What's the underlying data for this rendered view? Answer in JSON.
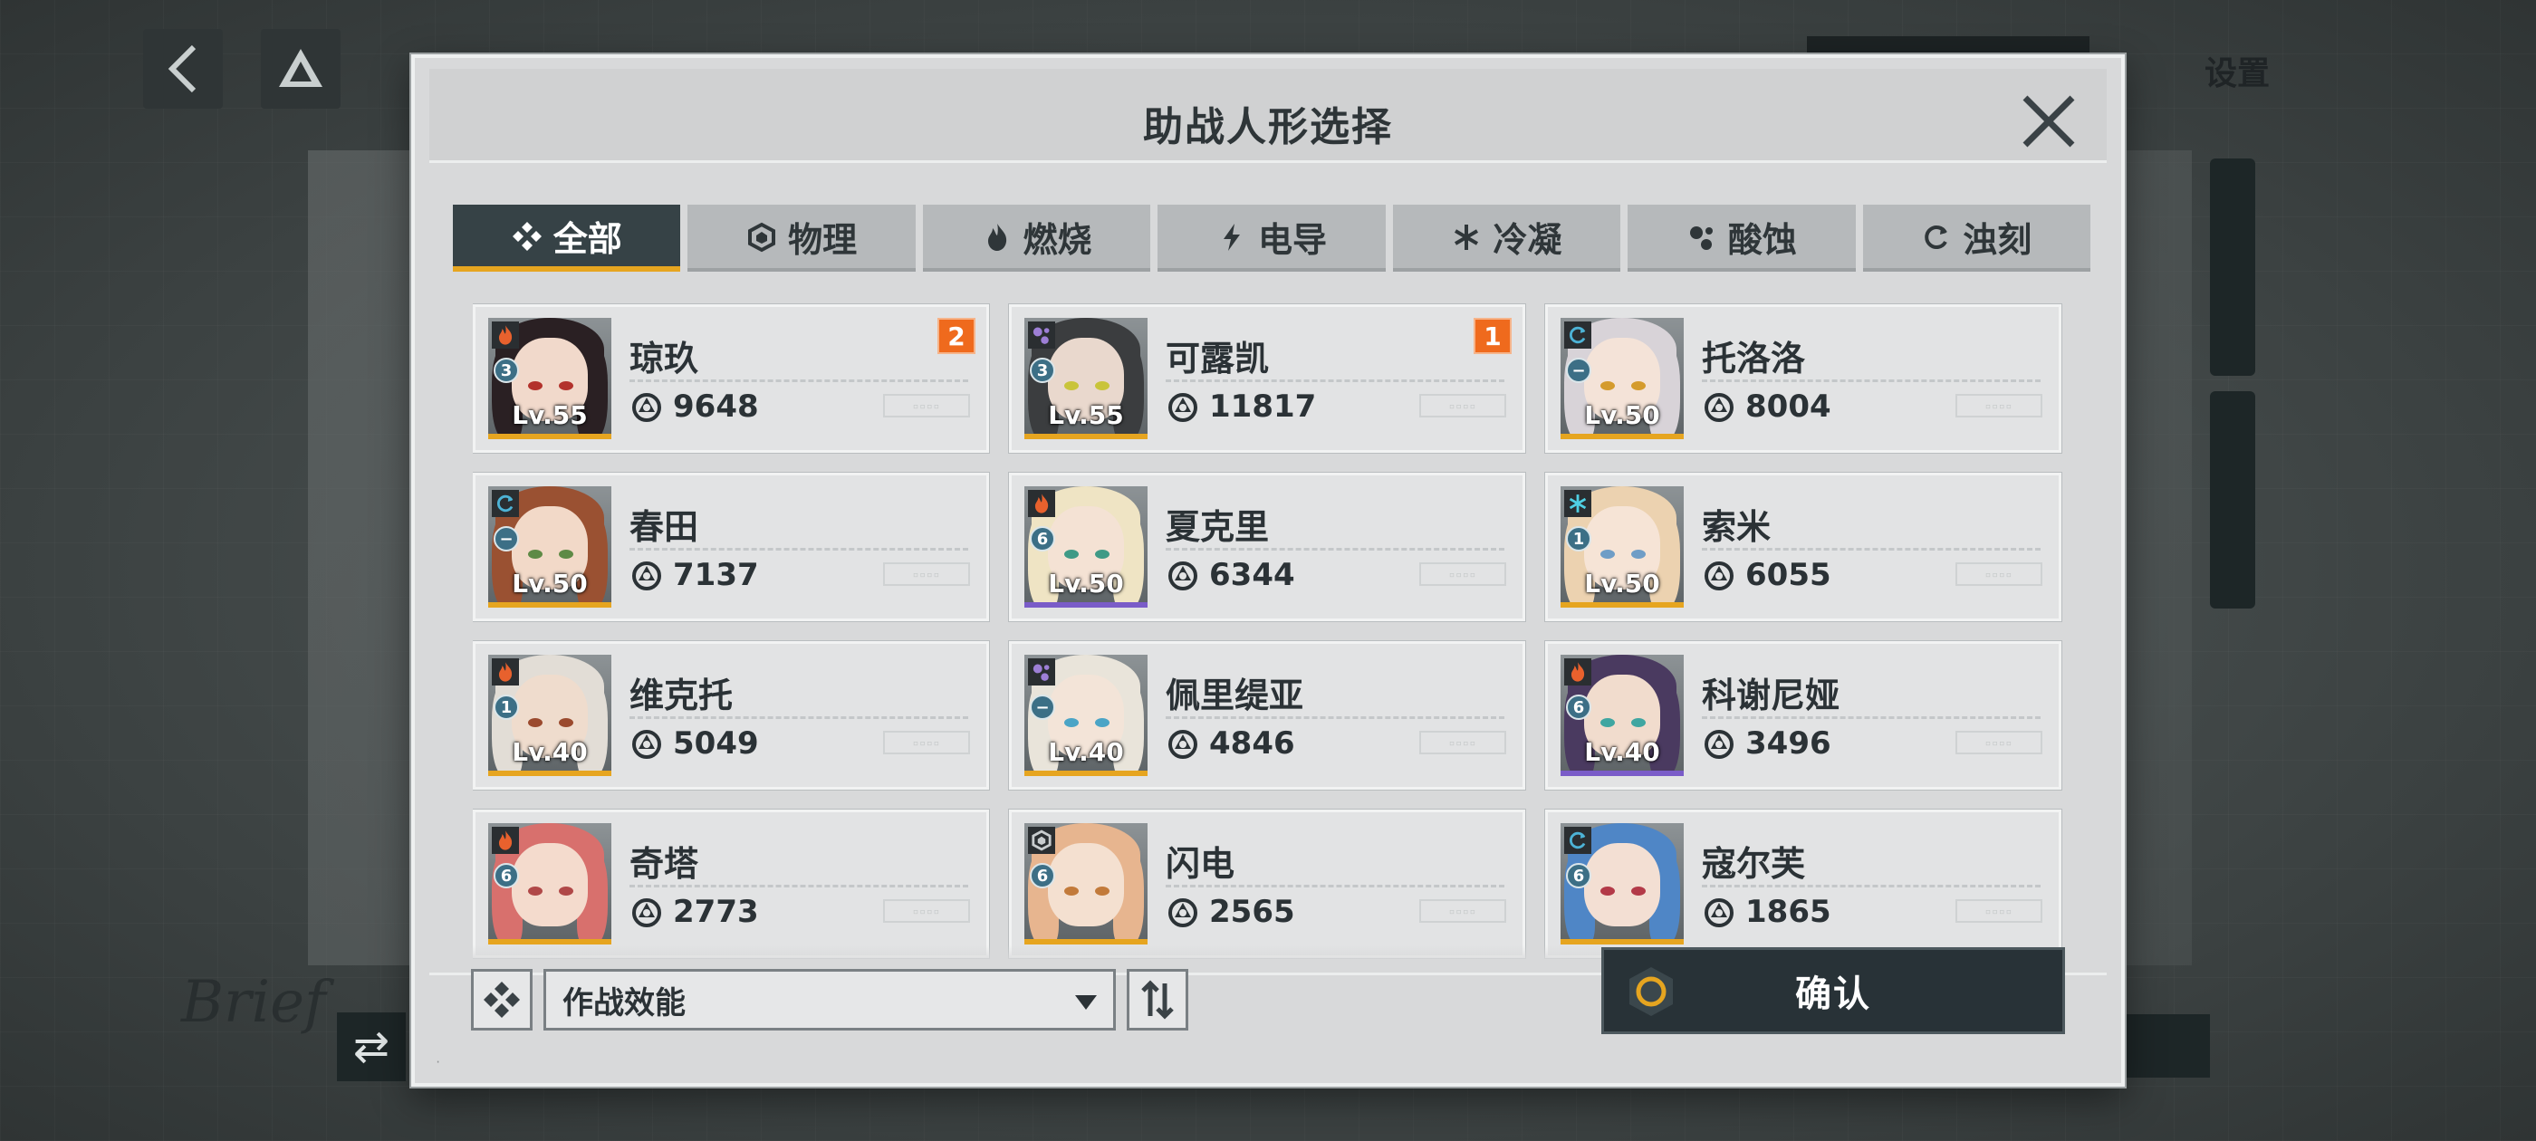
{
  "background": {
    "settings_label": "设置",
    "brief_text": "Brief"
  },
  "dialog": {
    "title": "助战人形选择"
  },
  "tabs": [
    {
      "label": "全部",
      "icon": "all-diamond-icon",
      "active": true
    },
    {
      "label": "物理",
      "icon": "physical-hexagon-icon",
      "active": false
    },
    {
      "label": "燃烧",
      "icon": "flame-icon",
      "active": false
    },
    {
      "label": "电导",
      "icon": "lightning-icon",
      "active": false
    },
    {
      "label": "冷凝",
      "icon": "snowflake-icon",
      "active": false
    },
    {
      "label": "酸蚀",
      "icon": "acid-drops-icon",
      "active": false
    },
    {
      "label": "浊刻",
      "icon": "swirl-icon",
      "active": false
    }
  ],
  "colors": {
    "accent_gold": "#e6a520",
    "accent_purple": "#7a5cc8",
    "badge_orange": "#ef6a1d",
    "dark_panel": "#283237"
  },
  "dolls": [
    {
      "name": "琼玖",
      "level": "Lv.55",
      "power": "9648",
      "rank": "3",
      "element": "flame-icon",
      "count_badge": "2",
      "rarity": "gold",
      "hair": "#2a2023",
      "skin": "#f1d9cb",
      "eye": "#b3322c"
    },
    {
      "name": "可露凯",
      "level": "Lv.55",
      "power": "11817",
      "rank": "3",
      "element": "acid-drops-icon",
      "count_badge": "1",
      "rarity": "gold",
      "hair": "#3b3d3f",
      "skin": "#e9d8cd",
      "eye": "#c9c43a"
    },
    {
      "name": "托洛洛",
      "level": "Lv.50",
      "power": "8004",
      "rank": "−",
      "element": "swirl-icon",
      "count_badge": "",
      "rarity": "gold",
      "hair": "#d8d3d8",
      "skin": "#f4e3d8",
      "eye": "#d49b2d"
    },
    {
      "name": "春田",
      "level": "Lv.50",
      "power": "7137",
      "rank": "−",
      "element": "swirl-icon",
      "count_badge": "",
      "rarity": "gold",
      "hair": "#9a5132",
      "skin": "#f2d9c8",
      "eye": "#5e8a46"
    },
    {
      "name": "夏克里",
      "level": "Lv.50",
      "power": "6344",
      "rank": "6",
      "element": "flame-icon",
      "count_badge": "",
      "rarity": "purple",
      "hair": "#efe4c4",
      "skin": "#f4e2d4",
      "eye": "#3f9a86"
    },
    {
      "name": "索米",
      "level": "Lv.50",
      "power": "6055",
      "rank": "1",
      "element": "snowflake-icon",
      "count_badge": "",
      "rarity": "gold",
      "hair": "#ecd2b0",
      "skin": "#f6e4d6",
      "eye": "#6f9dc6"
    },
    {
      "name": "维克托",
      "level": "Lv.40",
      "power": "5049",
      "rank": "1",
      "element": "flame-icon",
      "count_badge": "",
      "rarity": "gold",
      "hair": "#e2ddd6",
      "skin": "#efdccd",
      "eye": "#9b4a2e"
    },
    {
      "name": "佩里缇亚",
      "level": "Lv.40",
      "power": "4846",
      "rank": "−",
      "element": "acid-drops-icon",
      "count_badge": "",
      "rarity": "gold",
      "hair": "#e9e4da",
      "skin": "#f3e4d8",
      "eye": "#4aa4c6"
    },
    {
      "name": "科谢尼娅",
      "level": "Lv.40",
      "power": "3496",
      "rank": "6",
      "element": "flame-icon",
      "count_badge": "",
      "rarity": "purple",
      "hair": "#4a3a60",
      "skin": "#f1dccd",
      "eye": "#3fa6a1"
    },
    {
      "name": "奇塔",
      "level": "",
      "power": "2773",
      "rank": "6",
      "element": "flame-icon",
      "count_badge": "",
      "rarity": "gold",
      "hair": "#d8706d",
      "skin": "#f4dbcd",
      "eye": "#b04848"
    },
    {
      "name": "闪电",
      "level": "",
      "power": "2565",
      "rank": "6",
      "element": "physical-hexagon-icon",
      "count_badge": "",
      "rarity": "gold",
      "hair": "#e7b58f",
      "skin": "#f4e0d0",
      "eye": "#c27a3a"
    },
    {
      "name": "寇尔芙",
      "level": "",
      "power": "1865",
      "rank": "6",
      "element": "swirl-icon",
      "count_badge": "",
      "rarity": "gold",
      "hair": "#4f86c6",
      "skin": "#f3dfd3",
      "eye": "#b33a48"
    }
  ],
  "footer": {
    "sort_label": "作战效能",
    "filter_icon": "filter-diamond-icon",
    "sort_order_icon": "sort-order-icon",
    "confirm_label": "确认"
  }
}
